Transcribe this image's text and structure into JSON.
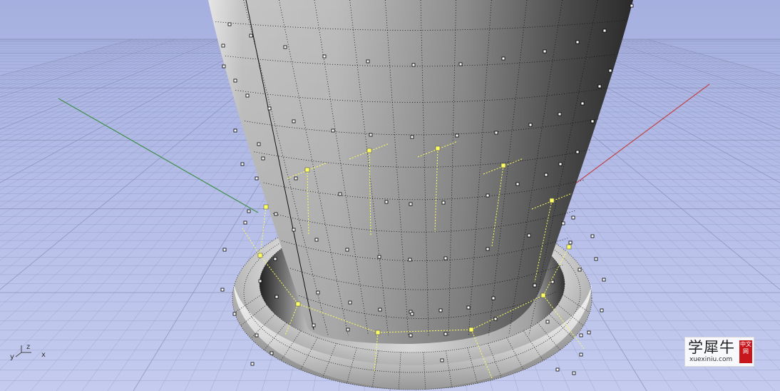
{
  "viewport": {
    "view": "Perspective",
    "background_top": "#a6b0e0",
    "background_bottom": "#c4cbef",
    "grid_color": "#8a92b8",
    "x_axis_color": "#c0444a",
    "y_axis_color": "#3f8f4a",
    "control_point_color": "#ffff60",
    "object": "vase with torus ring (control points on)"
  },
  "axis_widget": {
    "x_label": "x",
    "y_label": "y",
    "z_label": "z"
  },
  "watermark": {
    "text": "学犀牛",
    "url": "xuexiniu.com",
    "seal": "中文网"
  }
}
